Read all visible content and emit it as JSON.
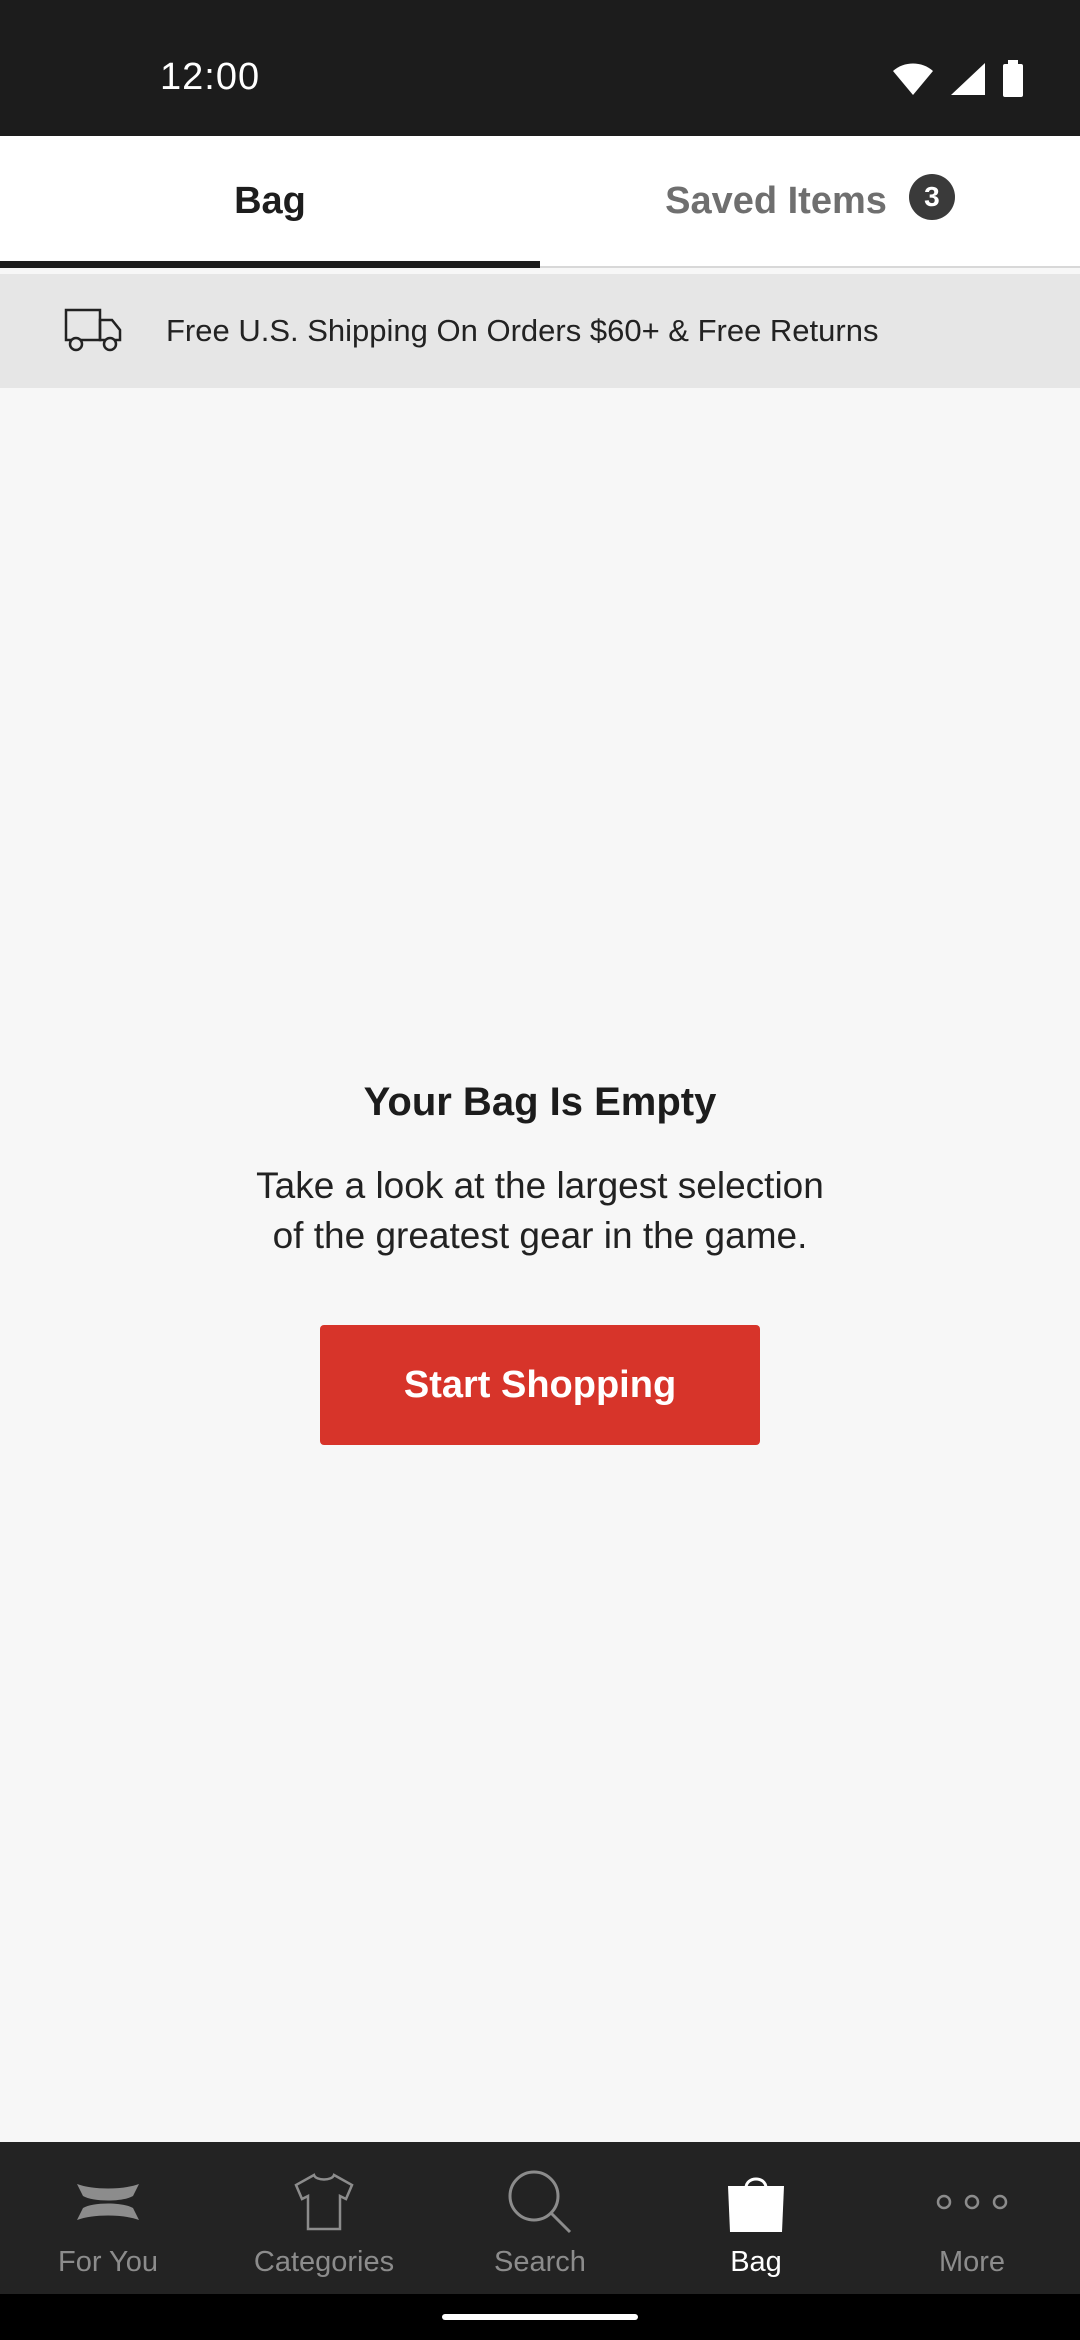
{
  "status_bar": {
    "time": "12:00"
  },
  "tabs": [
    {
      "label": "Bag",
      "active": true
    },
    {
      "label": "Saved Items",
      "badge": "3",
      "active": false
    }
  ],
  "shipping_banner": {
    "text": "Free U.S. Shipping On Orders $60+ & Free Returns",
    "icon": "truck-icon"
  },
  "empty_state": {
    "title": "Your Bag Is Empty",
    "subtitle_line1": "Take a look at the largest selection",
    "subtitle_line2": "of the greatest gear in the game.",
    "button_label": "Start Shopping"
  },
  "bottom_nav": {
    "items": [
      {
        "label": "For You",
        "icon": "brand-logo-icon"
      },
      {
        "label": "Categories",
        "icon": "shirt-icon"
      },
      {
        "label": "Search",
        "icon": "search-icon"
      },
      {
        "label": "Bag",
        "icon": "bag-icon",
        "active": true
      },
      {
        "label": "More",
        "icon": "more-dots-icon"
      }
    ]
  },
  "colors": {
    "accent": "#d7342a",
    "status_bar_bg": "#1c1c1c",
    "nav_bg": "#232323",
    "banner_bg": "#e6e6e6",
    "page_bg": "#f7f7f7"
  }
}
